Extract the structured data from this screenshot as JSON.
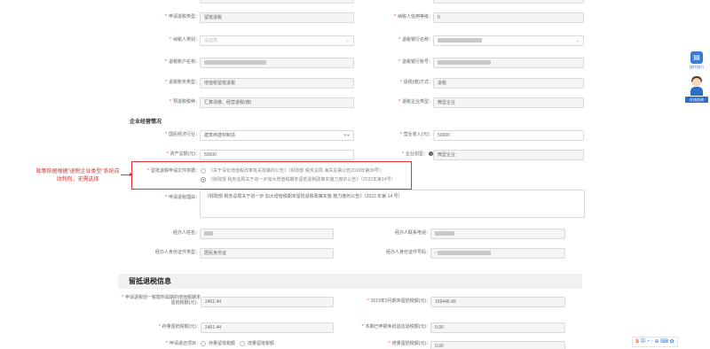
{
  "rows_top": [
    {
      "left_label": "申请退税类型：",
      "left_value": "留抵退税",
      "right_label": "纳税人信用等级：",
      "right_value": "0"
    },
    {
      "left_label": "纳税人类别：",
      "left_placeholder": "请选择",
      "right_label": "退税银行名称：",
      "right_value": ""
    },
    {
      "left_label": "退税账户名称：",
      "left_value": "",
      "right_label": "退税银行账号：",
      "right_value": ""
    },
    {
      "left_label": "退税账务类型：",
      "left_value": "增值税留抵退税",
      "right_label": "退税(缴)方式：",
      "right_value": "退税"
    },
    {
      "left_label": "预退税税种：",
      "left_value": "汇算清缴、经营退税(缴)",
      "right_label": "退税企业类型：",
      "right_value": "微型企业"
    }
  ],
  "section_business": "企业经营情况",
  "business": {
    "industry_label": "国民经济行业：",
    "industry_value": "建筑用建材制造",
    "revenue_label": "营业收入(元)：",
    "revenue_value": "50000",
    "assets_label": "资产总额(元)：",
    "assets_value": "50000",
    "scale_label": "企业划型：",
    "scale_value": "微型企业"
  },
  "basis": {
    "label": "留抵退税申请文件依据：",
    "option1": "《关于深化增值税改革有关政策的公告》（财政部 税务总局 海关总署公告2019年第39号）",
    "option2": "《财政部 税务总局关于进一步加大增值税期末留抵退税政策实施力度的公告》（2022年第14号）"
  },
  "annotation": "政策依据根据“退税企业类型”系统自动判别，无需选择",
  "reason": {
    "label": "申请退税理由：",
    "value": "《财政部 税务总局关于进一步 加大增值税期末留抵退税政策实施 施力度的公告》（2022 年第 14 号）"
  },
  "handler": {
    "name_label": "经办人姓名：",
    "phone_label": "经办人联系电话：",
    "id_type_label": "经办人身份证件类型：",
    "id_type_value": "居民身份证",
    "id_no_label": "经办人身份证件号码："
  },
  "section_refund": "留抵退税信息",
  "refund": {
    "r1_left_label": "申请退税前一税款所属期的增值税期末留抵税额(元)：",
    "r1_left_value": "2461.44",
    "r1_right_label": "2019年3月期末留抵税额(元)：",
    "r1_right_value": "159446.49",
    "r2_left_label": "存量留抵税额(元)：",
    "r2_left_value": "2461.44",
    "r2_right_label": "本期已申报免抵退应退税额(元)：",
    "r2_right_value": "0.00",
    "r3_left_label": "申请退还项目：",
    "r3_opt1": "存量留抵税额",
    "r3_opt2": "增量留抵税额",
    "r3_right_label": "增量留抵税额(元)：",
    "r3_right_value": "0.00"
  },
  "side": {
    "help_label": "操作指引",
    "chat_label": "在线咨询"
  },
  "ime": {
    "logo": "S",
    "text": "中・◦ ⊕ ⌨ ✿"
  }
}
